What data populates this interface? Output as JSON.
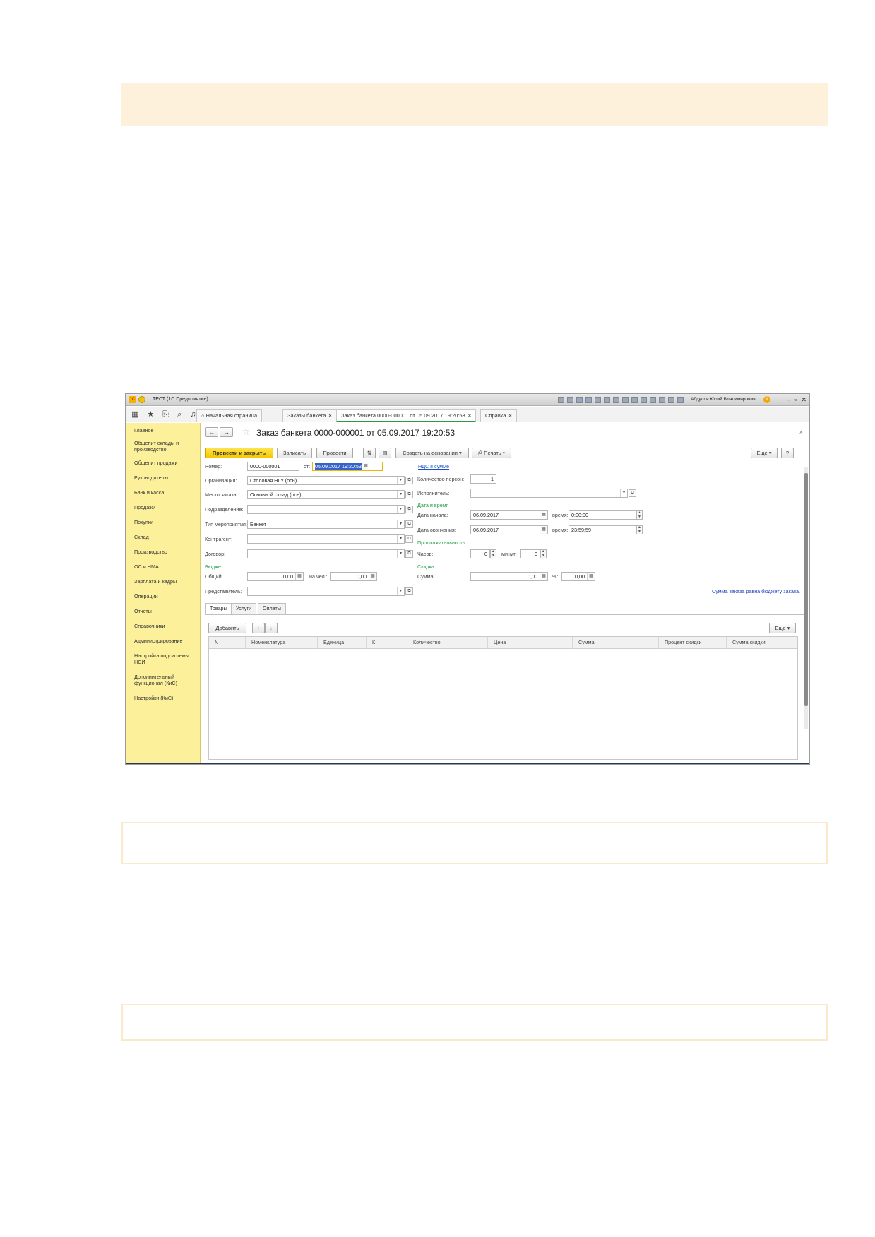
{
  "window": {
    "title": "ТЕСТ (1С:Предприятие)",
    "user": "Абдулов Юрий Владимирович"
  },
  "tabs": [
    {
      "label": "Начальная страница"
    },
    {
      "label": "Заказы банкета"
    },
    {
      "label": "Заказ банкета 0000-000001 от 05.09.2017 19:20:53"
    },
    {
      "label": "Справка"
    }
  ],
  "sidebar": {
    "items": [
      "Главное",
      "Общепит склады и производство",
      "Общепит продажи",
      "Руководителю",
      "Банк и касса",
      "Продажи",
      "Покупки",
      "Склад",
      "Производство",
      "ОС и НМА",
      "Зарплата и кадры",
      "Операции",
      "Отчеты",
      "Справочники",
      "Администрирование",
      "Настройка подсистемы НСИ",
      "Дополнительный функционал (КиС)",
      "Настройки (КиС)"
    ]
  },
  "document": {
    "title": "Заказ банкета 0000-000001 от 05.09.2017 19:20:53"
  },
  "toolbar": {
    "post_close": "Провести и закрыть",
    "save": "Записать",
    "post": "Провести",
    "create_based": "Создать на основании",
    "print": "Печать",
    "more": "Еще",
    "help": "?"
  },
  "form": {
    "number_label": "Номер:",
    "number_value": "0000-000001",
    "from_label": "от:",
    "date_value": "05.09.2017 19:20:53",
    "vat_link": "НДС в сумме",
    "org_label": "Организация:",
    "org_value": "Столовая НГУ (осн)",
    "place_label": "Место заказа:",
    "place_value": "Основной склад (осн)",
    "dept_label": "Подразделение:",
    "event_label": "Тип мероприятия:",
    "event_value": "Банкет",
    "contractor_label": "Контрагент:",
    "contract_label": "Договор:",
    "budget_group": "Бюджет",
    "total_label": "Общий:",
    "total_value": "0,00",
    "per_person_label": "на чел.:",
    "per_person_value": "0,00",
    "rep_label": "Представитель:",
    "persons_label": "Количество персон:",
    "persons_value": "1",
    "executor_label": "Исполнитель:",
    "datetime_group": "Дата и время",
    "start_label": "Дата начала:",
    "start_date": "06.09.2017",
    "time_label": "время:",
    "start_time": "0:00:00",
    "end_label": "Дата окончания:",
    "end_date": "06.09.2017",
    "end_time": "23:59:59",
    "duration_group": "Продолжительность",
    "hours_label": "Часов:",
    "hours_value": "0",
    "minutes_label": "минут:",
    "minutes_value": "0",
    "discount_group": "Скидка",
    "sum_label": "Сумма:",
    "sum_value": "0,00",
    "percent_label": "%:",
    "percent_value": "0,00",
    "budget_note": "Сумма заказа равна бюджету заказа."
  },
  "subtabs": [
    "Товары",
    "Услуги",
    "Оплаты"
  ],
  "table": {
    "add_label": "Добавить",
    "more_label": "Еще",
    "columns": [
      "N",
      "Номенклатура",
      "Единица",
      "К",
      "Количество",
      "Цена",
      "Сумма",
      "Процент скидки",
      "Сумма скидки"
    ]
  },
  "colors": {
    "sidebar": "#fdf09a",
    "primary_button": "#f5c800",
    "group_label": "#2aa04a",
    "link": "#1a4fc8",
    "note_fill": "#fdf1dc"
  }
}
